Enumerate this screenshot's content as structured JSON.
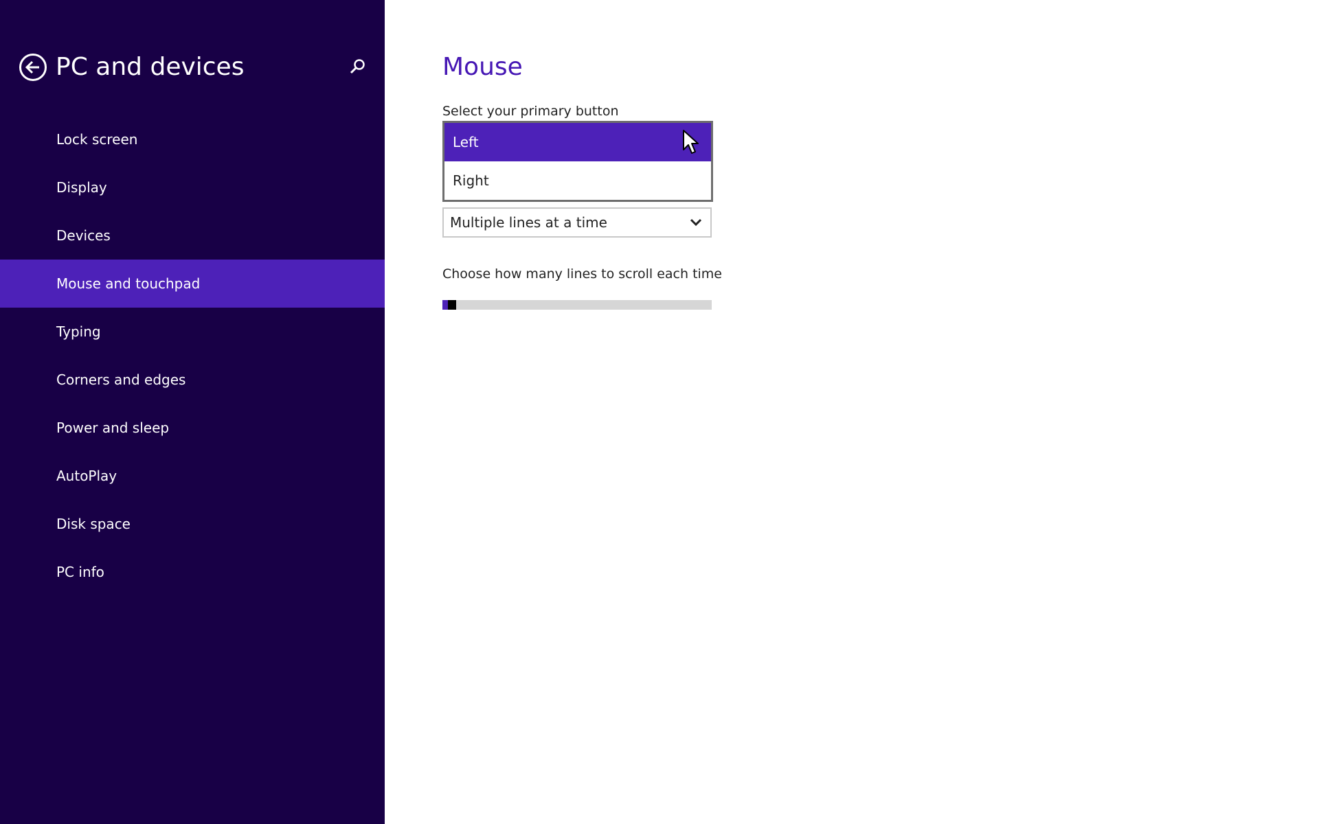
{
  "sidebar": {
    "title": "PC and devices",
    "back_icon": "back-arrow-circle-icon",
    "search_icon": "search-icon",
    "selected_index": 3,
    "items": [
      {
        "label": "Lock screen"
      },
      {
        "label": "Display"
      },
      {
        "label": "Devices"
      },
      {
        "label": "Mouse and touchpad"
      },
      {
        "label": "Typing"
      },
      {
        "label": "Corners and edges"
      },
      {
        "label": "Power and sleep"
      },
      {
        "label": "AutoPlay"
      },
      {
        "label": "Disk space"
      },
      {
        "label": "PC info"
      }
    ]
  },
  "main": {
    "title": "Mouse",
    "primary_button": {
      "label": "Select your primary button",
      "options": [
        "Left",
        "Right"
      ],
      "selected": "Left"
    },
    "scroll_mode": {
      "value": "Multiple lines at a time",
      "icon": "chevron-down-icon"
    },
    "lines_to_scroll": {
      "label": "Choose how many lines to scroll each time",
      "fraction": 0.02
    }
  },
  "colors": {
    "sidebar_background": "#180046",
    "accent": "#4d21b8",
    "title_text": "#4617b4",
    "main_background": "#ffffff"
  }
}
